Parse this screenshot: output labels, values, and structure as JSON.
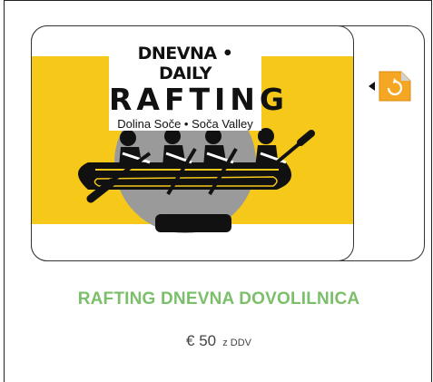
{
  "product": {
    "image_title_line1": "DNEVNA • DAILY",
    "image_title_line2": "RAFTING",
    "image_title_line3": "Dolina Soče • Soča Valley",
    "name": "RAFTING DNEVNA DOVOLILNICA",
    "price": "€ 50",
    "price_suffix": "z DDV",
    "flip_icon": "flip-card-icon"
  },
  "colors": {
    "band_yellow": "#f6c81a",
    "name_green": "#7bbf6a",
    "icon_orange": "#f5a623"
  }
}
